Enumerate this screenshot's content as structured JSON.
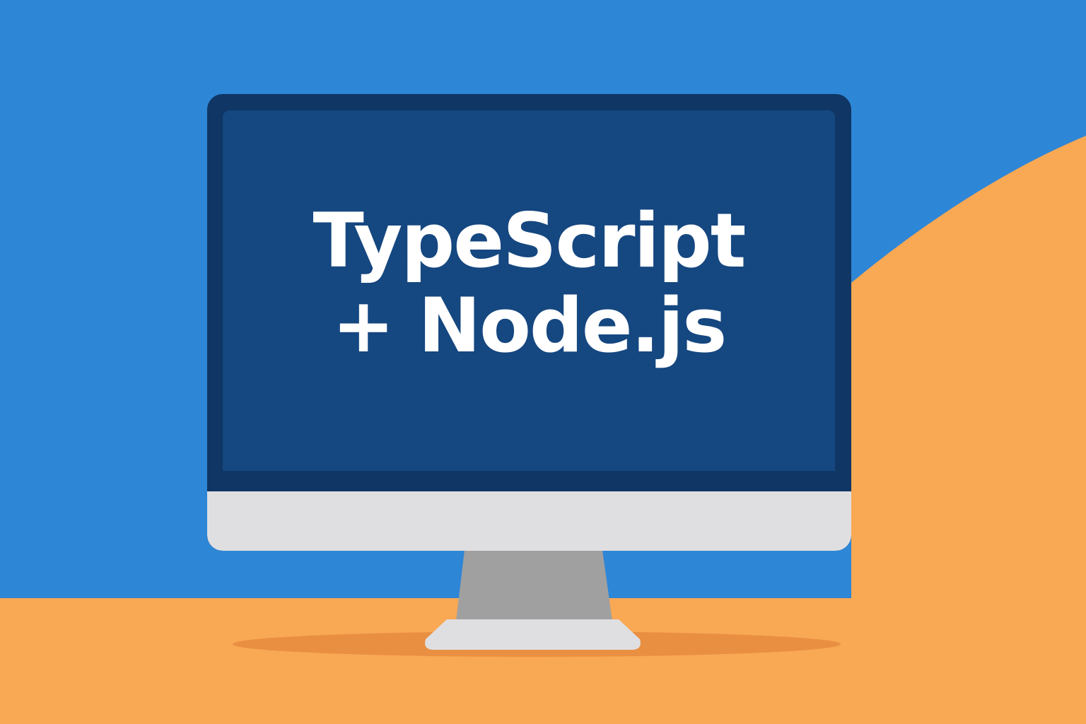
{
  "screen": {
    "line1": "TypeScript",
    "line2": "+ Node.js"
  },
  "colors": {
    "sky_blue": "#2e86d6",
    "orange": "#f9a854",
    "shadow_orange": "#e98f42",
    "bezel_dark_navy": "#0f3664",
    "screen_navy": "#154780",
    "chin_light_gray": "#dfdfe2",
    "stand_gray": "#a0a0a0",
    "text_white": "#ffffff"
  }
}
